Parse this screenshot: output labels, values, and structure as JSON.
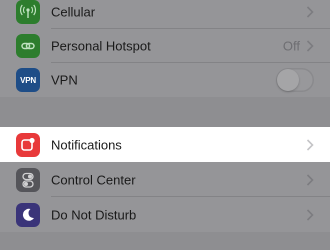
{
  "group1": {
    "cellular": {
      "label": "Cellular",
      "icon": "antenna-icon",
      "color": "#2d7d2d"
    },
    "hotspot": {
      "label": "Personal Hotspot",
      "detail": "Off",
      "icon": "chain-link-icon",
      "color": "#2d7d2d"
    },
    "vpn": {
      "label": "VPN",
      "icon_text": "VPN",
      "icon": "vpn-icon",
      "color": "#1e4d87",
      "toggle_on": false
    }
  },
  "group2": {
    "notifications": {
      "label": "Notifications",
      "icon": "notification-badge-icon",
      "color": "#e8393a"
    }
  },
  "group3": {
    "control_center": {
      "label": "Control Center",
      "icon": "toggles-icon",
      "color": "#55555a"
    },
    "do_not_disturb": {
      "label": "Do Not Disturb",
      "icon": "moon-icon",
      "color": "#3a3479"
    }
  },
  "colors": {
    "dim_background": "#8e8e91",
    "dim_row": "#959598",
    "highlight_row": "#ffffff"
  }
}
